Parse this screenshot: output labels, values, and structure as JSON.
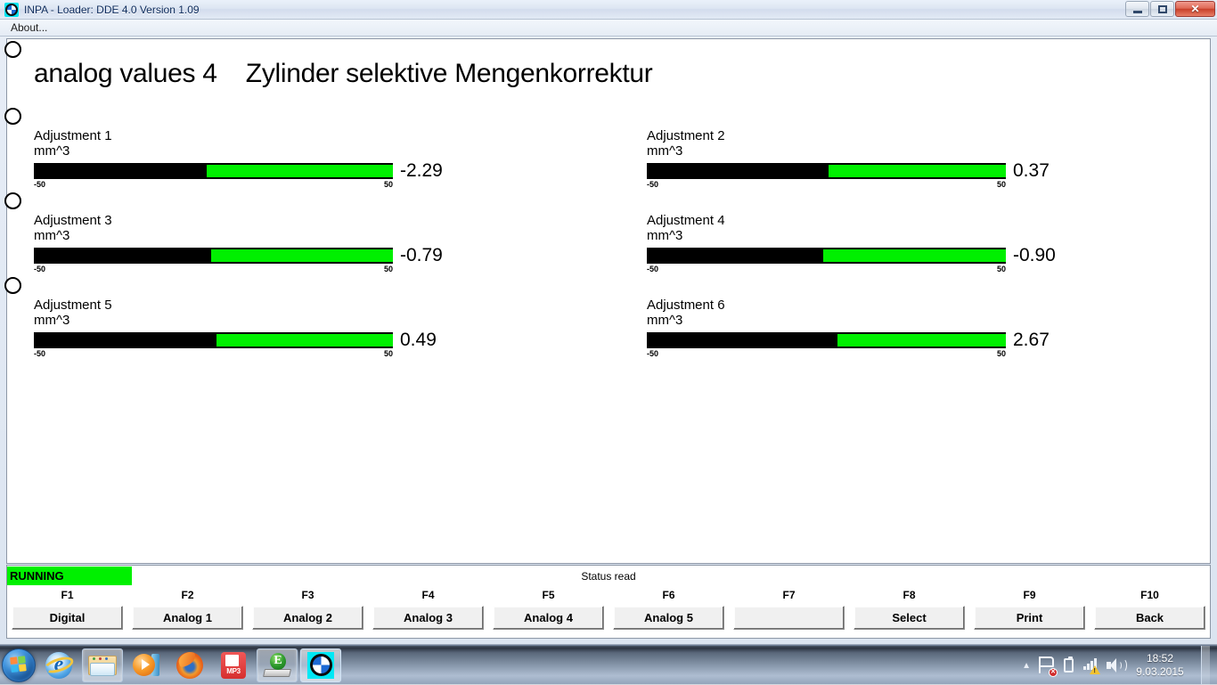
{
  "window": {
    "title": "INPA - Loader:  DDE 4.0 Version 1.09",
    "icon": "bmw-logo-icon",
    "minimize_label": "",
    "maximize_label": "",
    "close_label": "✕"
  },
  "menu": {
    "items": [
      {
        "label": "About..."
      }
    ]
  },
  "page": {
    "title": "analog values 4    Zylinder selektive Mengenkorrektur"
  },
  "gauges": [
    {
      "label": "Adjustment 1",
      "unit": "mm^3",
      "value": "-2.29",
      "value_num": -2.29,
      "min": "-50",
      "max": "50",
      "min_num": -50,
      "max_num": 50,
      "fill_pct": 48.2
    },
    {
      "label": "Adjustment 2",
      "unit": "mm^3",
      "value": "0.37",
      "value_num": 0.37,
      "min": "-50",
      "max": "50",
      "min_num": -50,
      "max_num": 50,
      "fill_pct": 50.6
    },
    {
      "label": "Adjustment 3",
      "unit": "mm^3",
      "value": "-0.79",
      "value_num": -0.79,
      "min": "-50",
      "max": "50",
      "min_num": -50,
      "max_num": 50,
      "fill_pct": 49.5
    },
    {
      "label": "Adjustment 4",
      "unit": "mm^3",
      "value": "-0.90",
      "value_num": -0.9,
      "min": "-50",
      "max": "50",
      "min_num": -50,
      "max_num": 50,
      "fill_pct": 49.2
    },
    {
      "label": "Adjustment 5",
      "unit": "mm^3",
      "value": "0.49",
      "value_num": 0.49,
      "min": "-50",
      "max": "50",
      "min_num": -50,
      "max_num": 50,
      "fill_pct": 50.9
    },
    {
      "label": "Adjustment 6",
      "unit": "mm^3",
      "value": "2.67",
      "value_num": 2.67,
      "min": "-50",
      "max": "50",
      "min_num": -50,
      "max_num": 50,
      "fill_pct": 53.0
    }
  ],
  "status": {
    "running_label": "RUNNING",
    "status_text": "Status read",
    "running_color": "#00f000"
  },
  "function_keys": [
    {
      "key": "F1",
      "label": "Digital"
    },
    {
      "key": "F2",
      "label": "Analog 1"
    },
    {
      "key": "F3",
      "label": "Analog 2"
    },
    {
      "key": "F4",
      "label": "Analog 3"
    },
    {
      "key": "F5",
      "label": "Analog 4"
    },
    {
      "key": "F6",
      "label": "Analog 5"
    },
    {
      "key": "F7",
      "label": ""
    },
    {
      "key": "F8",
      "label": "Select"
    },
    {
      "key": "F9",
      "label": "Print"
    },
    {
      "key": "F10",
      "label": "Back"
    }
  ],
  "taskbar": {
    "start_label": "Start",
    "items": [
      {
        "name": "internet-explorer",
        "label": "Internet Explorer",
        "glyph": "e"
      },
      {
        "name": "windows-explorer",
        "label": "Windows Explorer",
        "glyph": ""
      },
      {
        "name": "media-player",
        "label": "Windows Media Player",
        "glyph": ""
      },
      {
        "name": "firefox",
        "label": "Mozilla Firefox",
        "glyph": ""
      },
      {
        "name": "mp3-tool",
        "label": "MP3",
        "glyph": "MP3"
      },
      {
        "name": "ebook-reader",
        "label": "E",
        "glyph": "E"
      },
      {
        "name": "inpa-bmw",
        "label": "INPA",
        "glyph": ""
      }
    ],
    "tray": {
      "chevron": "▲",
      "action_center": "action-center-flag",
      "battery": "battery",
      "network": "network-warning",
      "volume": "speaker",
      "time": "18:52",
      "date": "9.03.2015"
    }
  },
  "colors": {
    "bar_track": "#00f000",
    "bar_fill": "#000000",
    "running_bg": "#00f000",
    "panel_bg": "#ffffff"
  }
}
